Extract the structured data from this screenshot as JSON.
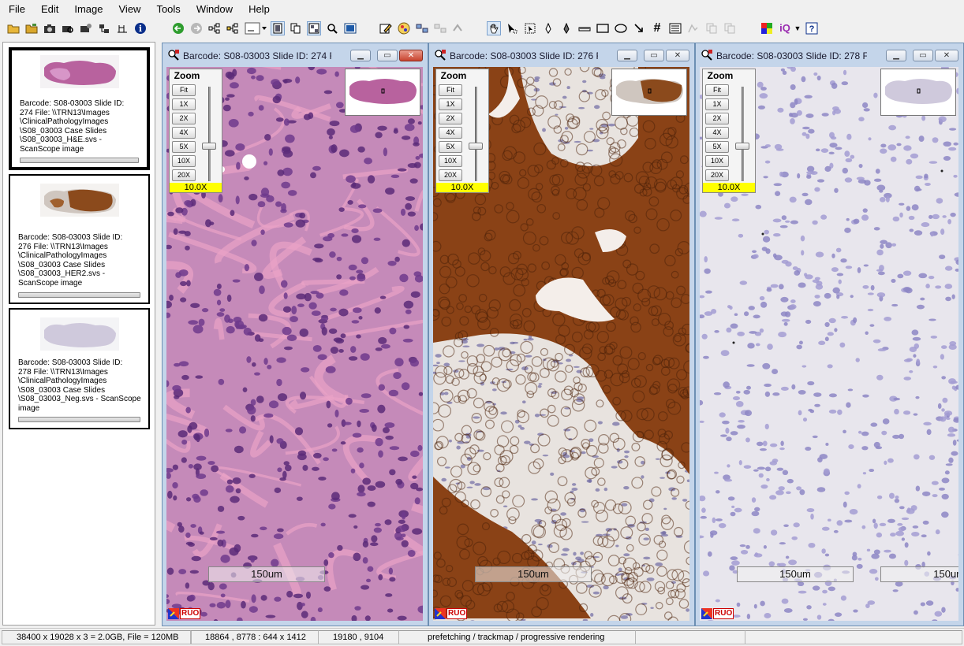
{
  "menu": [
    "File",
    "Edit",
    "Image",
    "View",
    "Tools",
    "Window",
    "Help"
  ],
  "toolbar": {
    "icons": [
      "open-folder-icon",
      "open-folder-alt-icon",
      "camera-icon",
      "camera-search-icon",
      "camera-gear-icon",
      "snapshot-tree-icon",
      "align-icon",
      "info-icon",
      "back-arrow-icon",
      "forward-arrow-icon",
      "tree-left-icon",
      "tree-right-icon",
      "layout-select-icon",
      "single-view-icon",
      "multi-view-icon",
      "grid-view-icon",
      "magnify-icon",
      "fit-screen-icon",
      "annotate-edit-icon",
      "color-palette-icon",
      "sync-icon",
      "sync-disabled-icon",
      "sync-disabled-alt-icon",
      "hand-pan-icon",
      "pointer-icon",
      "pointer-select-icon",
      "pen-icon",
      "pen-fill-icon",
      "ruler-icon",
      "rectangle-icon",
      "ellipse-icon",
      "arrow-icon",
      "hash-grid-icon",
      "list-icon",
      "copy-disabled-icon",
      "paste-disabled-icon",
      "paste-disabled-alt-icon",
      "color-tiles-icon",
      "iq-icon",
      "help-icon"
    ]
  },
  "thumbnails": [
    {
      "text": " Barcode: S08-03003   Slide ID:\n274  File: \\\\TRN13\\Images\n\\ClinicalPathologyImages\n\\S08_03003 Case Slides\n\\S08_03003_H&E.svs -\nScanScope image",
      "stain": "he",
      "selected": true
    },
    {
      "text": " Barcode: S08-03003   Slide ID:\n276  File: \\\\TRN13\\Images\n\\ClinicalPathologyImages\n\\S08_03003 Case Slides\n\\S08_03003_HER2.svs -\nScanScope image",
      "stain": "her2",
      "selected": false
    },
    {
      "text": " Barcode: S08-03003   Slide ID:\n278  File: \\\\TRN13\\Images\n\\ClinicalPathologyImages\n\\S08_03003 Case Slides\n\\S08_03003_Neg.svs - ScanScope\nimage",
      "stain": "neg",
      "selected": false
    }
  ],
  "windows": [
    {
      "title": "Barcode: S08-03003   Slide ID: 274  F...",
      "active": true,
      "stain": "he"
    },
    {
      "title": "Barcode: S08-03003   Slide ID: 276  F...",
      "active": false,
      "stain": "her2"
    },
    {
      "title": "Barcode: S08-03003   Slide ID: 278  F...",
      "active": false,
      "stain": "neg"
    }
  ],
  "zoom": {
    "title": "Zoom",
    "buttons": [
      "Fit",
      "1X",
      "2X",
      "4X",
      "5X",
      "10X",
      "20X"
    ],
    "level": "10.0X"
  },
  "scalebar": "150um",
  "ruo": "RUO",
  "statusbar": [
    "38400 x 19028 x 3 = 2.0GB, File = 120MB",
    "18864 , 8778 : 644 x 1412",
    "19180 , 9104",
    "prefetching / trackmap / progressive rendering",
    "",
    ""
  ],
  "colors": {
    "he_bg": "#c58ab9",
    "her2_bg": "#e8e3df",
    "neg_bg": "#e8e6ed",
    "zoom_level_bg": "#ffff00"
  }
}
